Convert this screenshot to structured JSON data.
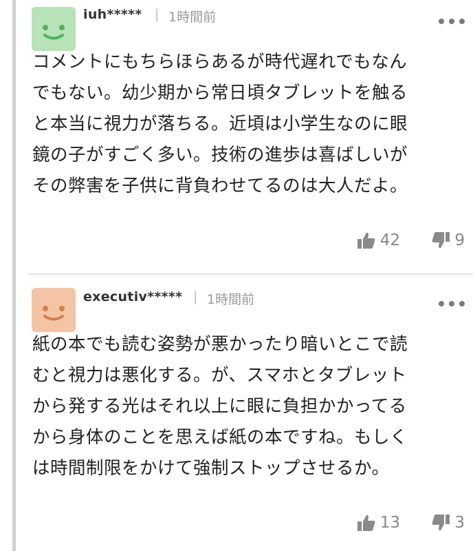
{
  "comments": [
    {
      "username": "iuh*****",
      "separator": "|",
      "time": "1時間前",
      "body": "コメントにもちらほらあるが時代遅れでもなん\nでもない。幼少期から常日頃タブレットを触る\nと本当に視力が落ちる。近頃は小学生なのに眼\n鏡の子がすごく多い。技術の進歩は喜ばしいが\nその弊害を子供に背負わせてるのは大人だよ。",
      "likes": "42",
      "dislikes": "9",
      "avatar_color": "#b8e2b8",
      "avatar_face_color": "#4fb35a"
    },
    {
      "username": "executiv*****",
      "separator": "|",
      "time": "1時間前",
      "body": "紙の本でも読む姿勢が悪かったり暗いとこで読\nむと視力は悪化する。が、スマホとタブレット\nから発する光はそれ以上に眼に負担かかってる\nから身体のことを思えば紙の本ですね。もしく\nは時間制限をかけて強制ストップさせるか。",
      "likes": "13",
      "dislikes": "3",
      "avatar_color": "#f4c4a4",
      "avatar_face_color": "#d4804a"
    }
  ],
  "icons": {
    "more": "more-dots-icon",
    "like": "thumbs-up-icon",
    "dislike": "thumbs-down-icon"
  }
}
